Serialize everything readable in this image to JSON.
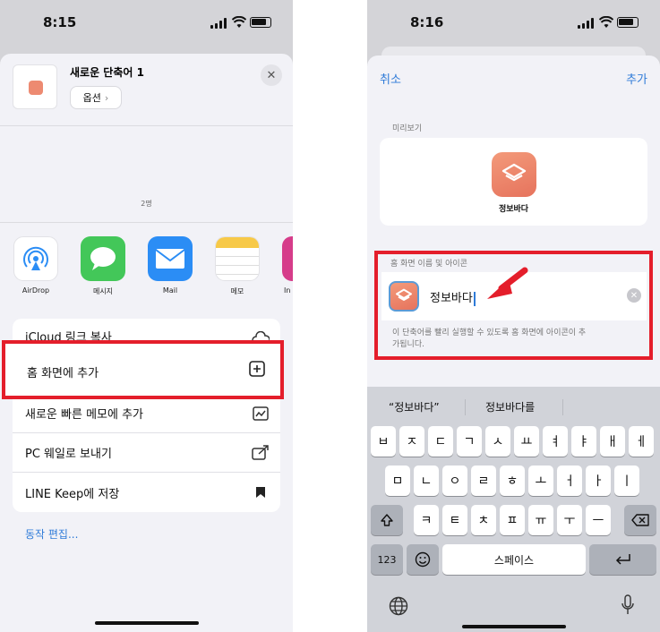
{
  "left": {
    "status_time": "8:15",
    "sheet_title": "새로운 단축어 1",
    "options_label": "옵션",
    "people_count": "2명",
    "apps": [
      {
        "label": "AirDrop"
      },
      {
        "label": "메시지"
      },
      {
        "label": "Mail"
      },
      {
        "label": "메모"
      },
      {
        "label": "In"
      }
    ],
    "actions": [
      {
        "label": "iCloud 링크 복사"
      },
      {
        "label": "홈 화면에 추가"
      },
      {
        "label": "새로운 빠른 메모에 추가"
      },
      {
        "label": "PC 웨일로 보내기"
      },
      {
        "label": "LINE Keep에 저장"
      }
    ],
    "edit_actions": "동작 편집..."
  },
  "right": {
    "status_time": "8:16",
    "cancel_label": "취소",
    "add_label": "추가",
    "preview_label": "미리보기",
    "shortcut_name": "정보바다",
    "name_label": "홈 화면 이름 및 아이콘",
    "name_value": "정보바다",
    "hint": "이 단축어를 빨리 실행할 수 있도록 홈 화면에 아이콘이 추가됩니다.",
    "suggestions": [
      "“정보바다”",
      "정보바다를"
    ],
    "keys_row1": [
      "ㅂ",
      "ㅈ",
      "ㄷ",
      "ㄱ",
      "ㅅ",
      "ㅛ",
      "ㅕ",
      "ㅑ",
      "ㅐ",
      "ㅔ"
    ],
    "keys_row2": [
      "ㅁ",
      "ㄴ",
      "ㅇ",
      "ㄹ",
      "ㅎ",
      "ㅗ",
      "ㅓ",
      "ㅏ",
      "ㅣ"
    ],
    "keys_row3": [
      "ㅋ",
      "ㅌ",
      "ㅊ",
      "ㅍ",
      "ㅠ",
      "ㅜ",
      "ㅡ"
    ],
    "key_123": "123",
    "key_space": "스페이스",
    "accent_color": "#e41e2b",
    "link_color": "#2f7bd8",
    "icon_color": "#ed8a71"
  }
}
